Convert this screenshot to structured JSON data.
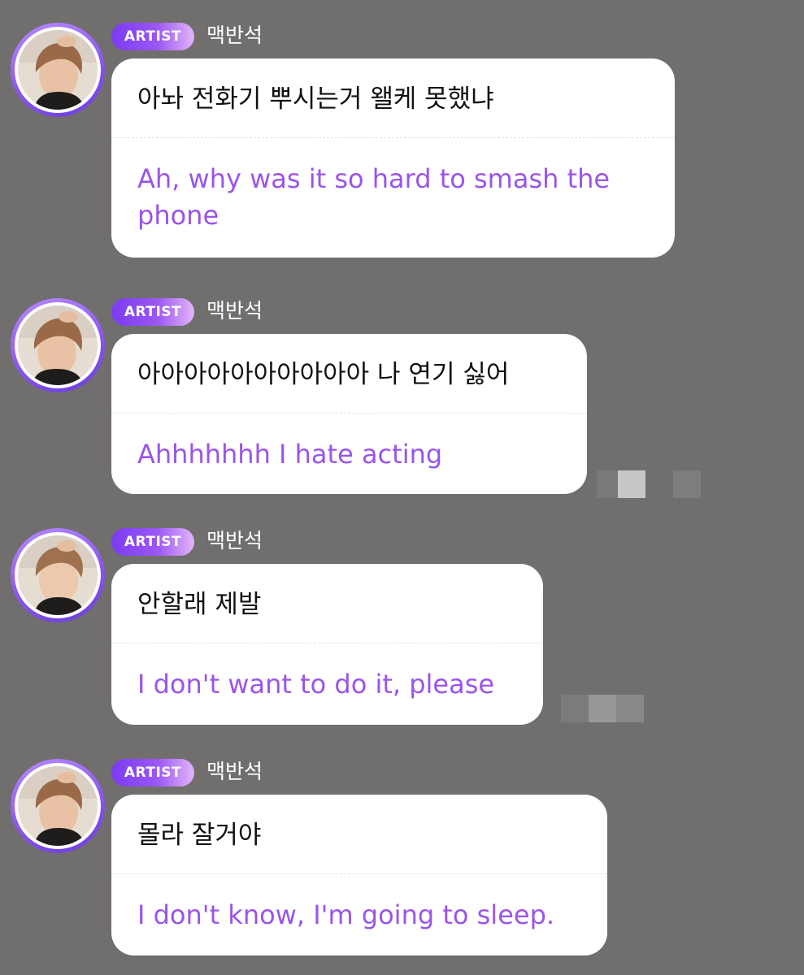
{
  "theme": {
    "background": "#716e6e",
    "bubble": "#ffffff",
    "original_text": "#111111",
    "translation_text": "#9a55e8",
    "badge_start": "#7a3cf2",
    "badge_end": "#e3b4fa"
  },
  "messages": [
    {
      "badge": "ARTIST",
      "author": "맥반석",
      "avatar_icon": "profile-photo",
      "original": "아놔 전화기 뿌시는거 왤케 못했냐",
      "translation": "Ah, why was it so hard to smash the phone"
    },
    {
      "badge": "ARTIST",
      "author": "맥반석",
      "avatar_icon": "profile-photo",
      "original": "아아아아아아아아아아 나 연기 싫어",
      "translation": "Ahhhhhhh I hate acting"
    },
    {
      "badge": "ARTIST",
      "author": "맥반석",
      "avatar_icon": "profile-photo",
      "original": "안할래 제발",
      "translation": "I don't want to do it, please"
    },
    {
      "badge": "ARTIST",
      "author": "맥반석",
      "avatar_icon": "profile-photo",
      "original": "몰라 잘거야",
      "translation": "I don't know, I'm going to sleep."
    }
  ]
}
